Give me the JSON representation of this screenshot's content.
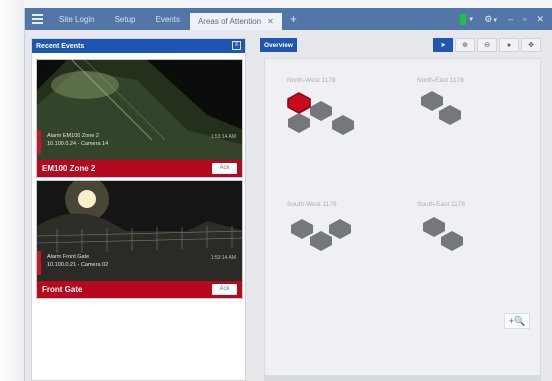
{
  "app": {
    "tabs": [
      {
        "label": "Site Login"
      },
      {
        "label": "Setup"
      },
      {
        "label": "Events"
      },
      {
        "label": "Areas of Attention",
        "active": true
      }
    ],
    "add_tab": "+",
    "status_color": "#18c43f",
    "window_controls": {
      "minimize": "–",
      "maximize": "▫",
      "close": "✕"
    }
  },
  "left_panel": {
    "title": "Recent Events",
    "events": [
      {
        "title": "Alarm EM100 Zone 2",
        "source": "10.100.0.24 - Camera 14",
        "time": "1:53:14 AM",
        "name": "EM100 Zone 2",
        "button": "Ack"
      },
      {
        "title": "Alarm Front Gate",
        "source": "10.100.0.21 - Camera 02",
        "time": "1:53:14 AM",
        "name": "Front Gate",
        "button": "Ack"
      }
    ]
  },
  "right_panel": {
    "tab": "Overview",
    "toolbar": [
      {
        "icon": "pointer-icon",
        "glyph": "➤",
        "active": true
      },
      {
        "icon": "zoom-in-icon",
        "glyph": "⊕"
      },
      {
        "icon": "zoom-out-icon",
        "glyph": "⊖"
      },
      {
        "icon": "record-icon",
        "glyph": "●"
      },
      {
        "icon": "pan-icon",
        "glyph": "✥"
      }
    ],
    "quadrants": [
      {
        "label": "North-West 1178"
      },
      {
        "label": "North-East 1178"
      },
      {
        "label": "South-West 1178"
      },
      {
        "label": "South-East 1178"
      }
    ],
    "zoom_button": "+🔍"
  },
  "colors": {
    "accent": "#1d56b3",
    "alarm": "#b6081e",
    "hex_normal": "#74777c",
    "hex_alarm": "#c90a1e"
  }
}
